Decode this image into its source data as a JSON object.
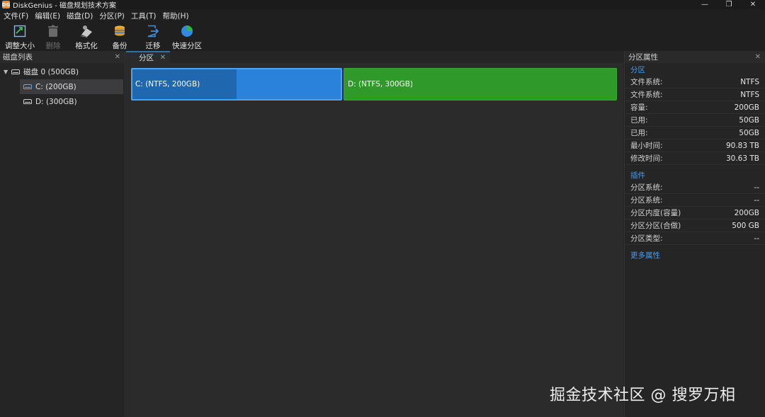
{
  "window": {
    "app_icon_text": "DG",
    "title": "DiskGenius - 磁盘规划技术方案",
    "controls": {
      "minimize": "—",
      "maximize": "❐",
      "close": "✕"
    }
  },
  "menu": [
    "文件(F)",
    "编辑(E)",
    "磁盘(D)",
    "分区(P)",
    "工具(T)",
    "帮助(H)"
  ],
  "toolbar": [
    {
      "label": "调整大小",
      "icon": "resize-icon",
      "enabled": true
    },
    {
      "label": "删除",
      "icon": "trash-icon",
      "enabled": false
    },
    {
      "label": "格式化",
      "icon": "format-icon",
      "enabled": true
    },
    {
      "label": "备份",
      "icon": "database-icon",
      "enabled": true
    },
    {
      "label": "迁移",
      "icon": "migrate-icon",
      "enabled": true
    },
    {
      "label": "快速分区",
      "icon": "pie-icon",
      "enabled": true
    }
  ],
  "left_panel": {
    "title": "磁盘列表",
    "close": "✕",
    "disk": {
      "label": "磁盘 0 (500GB)",
      "expanded": true
    },
    "partitions": [
      {
        "label": "C: (200GB)",
        "selected": true
      },
      {
        "label": "D: (300GB)",
        "selected": false
      }
    ]
  },
  "center": {
    "tab": {
      "label": "分区",
      "close": "✕"
    },
    "disk_map": {
      "c": {
        "label": "C: (NTFS, 200GB)",
        "used_fraction": 0.5,
        "color": "#2a83d8"
      },
      "d": {
        "label": "D: (NTFS, 300GB)",
        "color": "#2f9a2a"
      }
    }
  },
  "right_panel": {
    "title": "分区属性",
    "close": "✕",
    "section1_title": "分区",
    "section1": [
      {
        "key": "文件系统:",
        "value": "NTFS"
      },
      {
        "key": "文件系统:",
        "value": "NTFS"
      },
      {
        "key": "容量:",
        "value": "200GB"
      },
      {
        "key": "已用:",
        "value": "50GB"
      },
      {
        "key": "已用:",
        "value": "50GB"
      },
      {
        "key": "最小时间:",
        "value": "90.83 TB"
      },
      {
        "key": "修改时间:",
        "value": "30.63 TB"
      }
    ],
    "section2_title": "插件",
    "section2": [
      {
        "key": "分区系统:",
        "value": "--"
      },
      {
        "key": "分区系统:",
        "value": "--"
      },
      {
        "key": "分区内度(容量)",
        "value": "200GB"
      },
      {
        "key": "分区分区(合做)",
        "value": "500 GB"
      },
      {
        "key": "分区类型:",
        "value": "--"
      }
    ],
    "more_link": "更多属性"
  },
  "watermark": "掘金技术社区 @ 搜罗万相",
  "colors": {
    "accent": "#4a9be6",
    "partition_c": "#2a83d8",
    "partition_d": "#2f9a2a"
  }
}
